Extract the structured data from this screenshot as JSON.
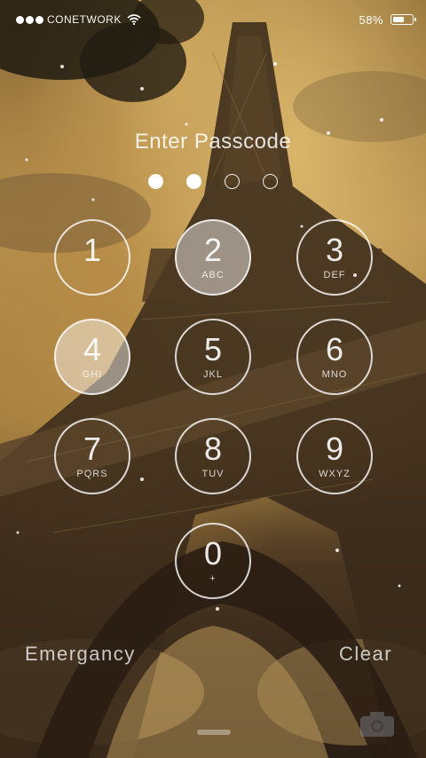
{
  "status_bar": {
    "carrier": "CONETWORK",
    "battery_percent_text": "58%",
    "battery_level": 0.58
  },
  "lock_screen": {
    "title": "Enter Passcode",
    "dots_total": 4,
    "dots_filled": 2,
    "keys": [
      {
        "num": "1",
        "letters": ""
      },
      {
        "num": "2",
        "letters": "ABC"
      },
      {
        "num": "3",
        "letters": "DEF"
      },
      {
        "num": "4",
        "letters": "GHI"
      },
      {
        "num": "5",
        "letters": "JKL"
      },
      {
        "num": "6",
        "letters": "MNO"
      },
      {
        "num": "7",
        "letters": "PQRS"
      },
      {
        "num": "8",
        "letters": "TUV"
      },
      {
        "num": "9",
        "letters": "WXYZ"
      },
      {
        "num": "0",
        "letters": "+"
      }
    ],
    "emergency_label": "Emergancy",
    "clear_label": "Clear"
  },
  "icons": {
    "signal": "signal-dots-icon",
    "wifi": "wifi-icon",
    "battery": "battery-icon",
    "camera": "camera-icon"
  }
}
